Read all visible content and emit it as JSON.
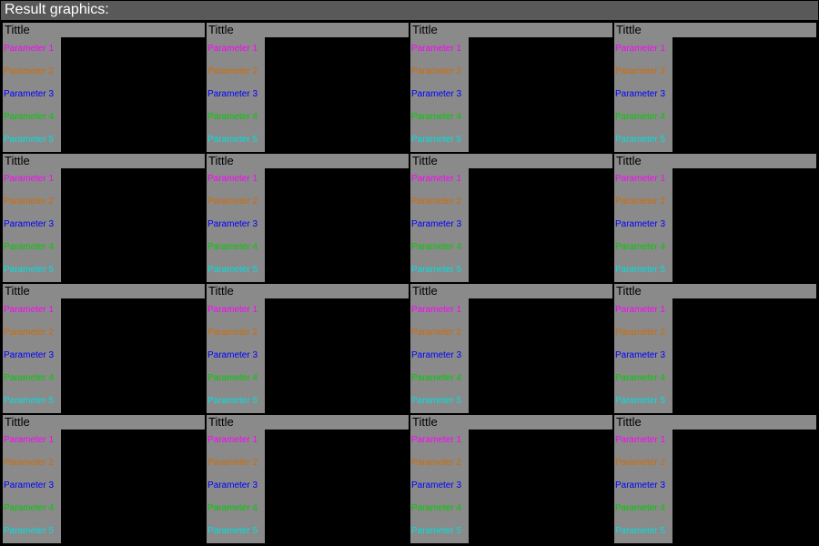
{
  "header": {
    "title": "Result graphics:"
  },
  "palette": [
    "#ff00ff",
    "#d26a00",
    "#0000ff",
    "#00cc00",
    "#00e0e0"
  ],
  "cell_template": {
    "title": "Tittle",
    "params": [
      "Parameter 1",
      "Parameter 2",
      "Parameter 3",
      "Parameter 4",
      "Parameter 5"
    ]
  },
  "grid": {
    "rows": 4,
    "cols": 4
  },
  "chart_data": {
    "type": "line",
    "note": "4x4 grid of identical empty plot panels; no data series rendered, axes not labeled",
    "series": [],
    "title": "Tittle",
    "legend": [
      "Parameter 1",
      "Parameter 2",
      "Parameter 3",
      "Parameter 4",
      "Parameter 5"
    ]
  }
}
